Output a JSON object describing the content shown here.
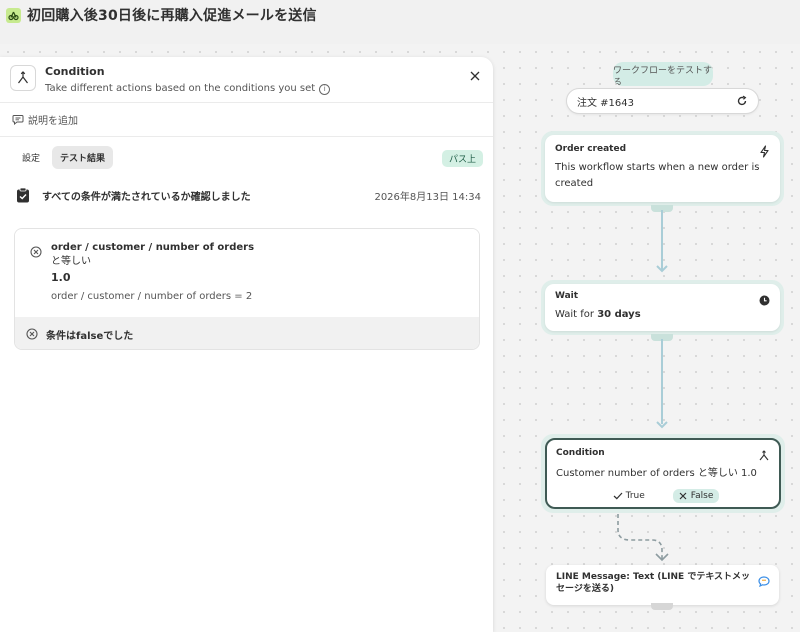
{
  "window": {
    "title": "初回購入後30日後に再購入促進メールを送信"
  },
  "panel": {
    "title": "Condition",
    "subtitle": "Take different actions based on the conditions you set",
    "add_description": "説明を追加",
    "tabs": [
      {
        "label": "設定",
        "active": false
      },
      {
        "label": "テスト結果",
        "active": true
      }
    ],
    "status_badge": "パス上",
    "check": {
      "title": "すべての条件が満たされているか確認しました",
      "timestamp": "2026年8月13日 14:34"
    },
    "result": {
      "field": "order / customer / number of orders",
      "operator": "と等しい",
      "value": "1.0",
      "actual": "order / customer / number of orders = 2",
      "conclusion": "条件はfalseでした"
    }
  },
  "flow": {
    "test_button": "ワークフローをテストする",
    "order_selector": "注文 #1643",
    "nodes": {
      "order_created": {
        "title": "Order created",
        "body": "This workflow starts when a new order is created"
      },
      "wait": {
        "title": "Wait",
        "body_prefix": "Wait for ",
        "body_value": "30 days"
      },
      "condition": {
        "title": "Condition",
        "body": "Customer number of orders と等しい 1.0",
        "true_label": "True",
        "false_label": "False"
      },
      "line_message": {
        "title": "LINE Message: Text (LINE でテキストメッセージを送る)"
      }
    }
  },
  "colors": {
    "accent": "#c7ea8f",
    "teal_bg": "#dfeeea",
    "connector": "#a9cdd7",
    "selected_border": "#3f5a54"
  }
}
